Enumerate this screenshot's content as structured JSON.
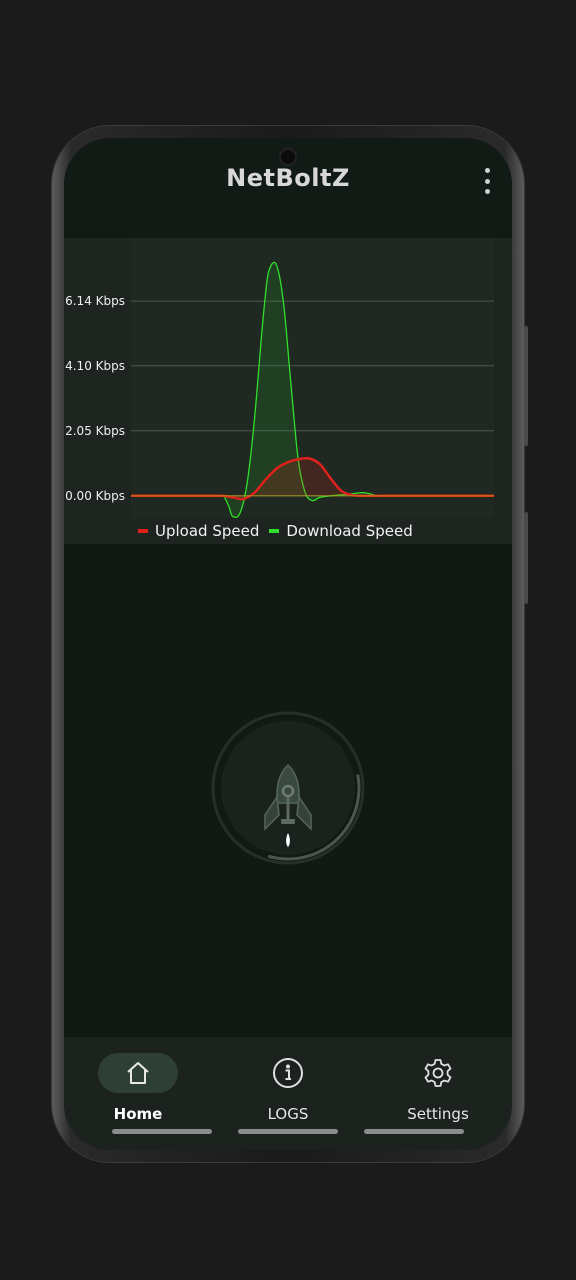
{
  "app": {
    "title": "NetBoltZ",
    "menu_icon": "more-vert-icon"
  },
  "chart_data": {
    "type": "line",
    "y_ticks": [
      "0.00 Kbps",
      "2.05 Kbps",
      "4.10 Kbps",
      "6.14 Kbps"
    ],
    "y_tick_values": [
      0,
      2.05,
      4.1,
      6.14
    ],
    "ylim": [
      -0.7,
      7.5
    ],
    "grid": true,
    "legend_placement": "bottom-left",
    "series": [
      {
        "name": "Upload Speed",
        "color": "#e0201b",
        "x": [
          0,
          10,
          20,
          25,
          28,
          31,
          34,
          37,
          40,
          43,
          46,
          49,
          52,
          55,
          58,
          61,
          64,
          70,
          80,
          90,
          100
        ],
        "values": [
          0,
          0,
          0,
          0,
          -0.05,
          -0.1,
          0.1,
          0.5,
          0.85,
          1.05,
          1.15,
          1.18,
          1.0,
          0.55,
          0.15,
          0.02,
          0,
          0,
          0,
          0,
          0
        ]
      },
      {
        "name": "Download Speed",
        "color": "#2ee02b",
        "x": [
          0,
          10,
          20,
          25,
          26,
          27,
          28,
          30,
          32,
          34,
          36,
          37,
          38,
          40,
          42,
          44,
          46,
          48,
          50,
          52,
          55,
          60,
          64,
          68,
          70,
          80,
          90,
          100
        ],
        "values": [
          0,
          0,
          0,
          0,
          -0.1,
          -0.35,
          -0.65,
          -0.55,
          0.4,
          2.4,
          5.1,
          6.3,
          7.1,
          7.3,
          6.1,
          3.6,
          1.2,
          0.1,
          -0.15,
          -0.05,
          0,
          0.05,
          0.1,
          0,
          0,
          0,
          0,
          0
        ]
      }
    ]
  },
  "main": {
    "launch_icon": "rocket-icon",
    "progress_fraction": 0.32
  },
  "bottom_nav": {
    "items": [
      {
        "label": "Home",
        "icon": "home-icon",
        "active": true
      },
      {
        "label": "LOGS",
        "icon": "info-icon",
        "active": false
      },
      {
        "label": "Settings",
        "icon": "gear-icon",
        "active": false
      }
    ]
  }
}
